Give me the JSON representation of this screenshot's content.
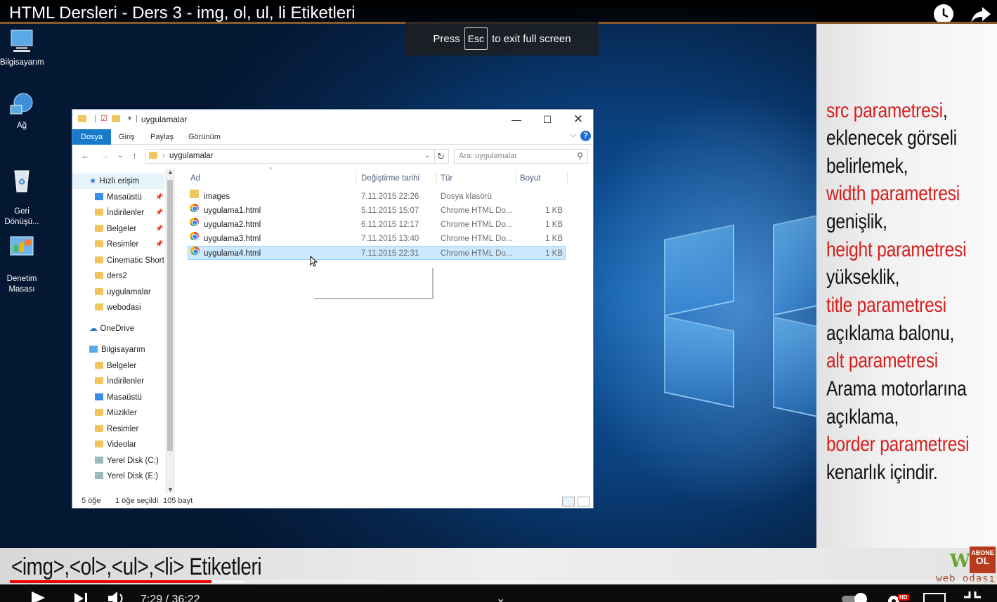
{
  "video": {
    "title": "HTML Dersleri - Ders 3 - img, ol, ul, li Etiketleri",
    "fullscreen_toast": {
      "before": "Press",
      "key": "Esc",
      "after": "to exit full screen"
    },
    "time": "7:29 / 36:22",
    "progress": 0.206,
    "buffered": 0.24,
    "hd_badge": "HD"
  },
  "desktop_icons": [
    {
      "label": "Bilgisayarım",
      "icon": "computer-icon"
    },
    {
      "label": "Ağ",
      "icon": "network-icon"
    },
    {
      "label": "Geri\nDönüşü...",
      "icon": "recycle-bin-icon"
    },
    {
      "label": "Denetim\nMasası",
      "icon": "control-panel-icon"
    }
  ],
  "explorer": {
    "title": "uygulamalar",
    "tabs": [
      "Dosya",
      "Giriş",
      "Paylaş",
      "Görünüm"
    ],
    "address": "uygulamalar",
    "search_placeholder": "Ara: uygulamalar",
    "sidebar": {
      "quick_access": "Hızlı erişim",
      "quick_items": [
        "Masaüstü",
        "İndirilenler",
        "Belgeler",
        "Resimler",
        "Cinematic Short",
        "ders2",
        "uygulamalar",
        "webodasi"
      ],
      "onedrive": "OneDrive",
      "computer": "Bilgisayarım",
      "computer_items": [
        "Belgeler",
        "İndirilenler",
        "Masaüstü",
        "Müzikler",
        "Resimler",
        "Videolar",
        "Yerel Disk (C:)",
        "Yerel Disk (E:)"
      ]
    },
    "columns": [
      "Ad",
      "Değiştirme tarihi",
      "Tür",
      "Boyut"
    ],
    "files": [
      {
        "name": "images",
        "date": "7.11.2015 22:26",
        "type": "Dosya klasörü",
        "size": "",
        "icon": "folder-icon"
      },
      {
        "name": "uygulama1.html",
        "date": "5.11.2015 15:07",
        "type": "Chrome HTML Do...",
        "size": "1 KB",
        "icon": "chrome-icon"
      },
      {
        "name": "uygulama2.html",
        "date": "6.11.2015 12:17",
        "type": "Chrome HTML Do...",
        "size": "1 KB",
        "icon": "chrome-icon"
      },
      {
        "name": "uygulama3.html",
        "date": "7.11.2015 13:40",
        "type": "Chrome HTML Do...",
        "size": "1 KB",
        "icon": "chrome-icon"
      },
      {
        "name": "uygulama4.html",
        "date": "7.11.2015 22:31",
        "type": "Chrome HTML Do...",
        "size": "1 KB",
        "icon": "chrome-icon",
        "selected": true
      }
    ],
    "status": {
      "count": "5 öğe",
      "selected": "1 öğe seçildi",
      "size": "105 bayt"
    }
  },
  "caption_panel": [
    {
      "text": "src parametresi,",
      "red_part": "src parametresi"
    },
    {
      "text": "eklenecek görseli"
    },
    {
      "text": "belirlemek,"
    },
    {
      "text": "width parametresi",
      "red_part": "width parametresi"
    },
    {
      "text": "genişlik,"
    },
    {
      "text": "height parametresi",
      "red_part": "height parametresi"
    },
    {
      "text": "yükseklik,"
    },
    {
      "text": "title parametresi",
      "red_part": "title parametresi"
    },
    {
      "text": "açıklama balonu,"
    },
    {
      "text": "alt parametresi",
      "red_part": "alt parametresi"
    },
    {
      "text": "Arama motorlarına"
    },
    {
      "text": "açıklama,"
    },
    {
      "text": "border parametresi",
      "red_part": "border parametresi"
    },
    {
      "text": "kenarlık içindir."
    }
  ],
  "lower_third": "<img>,<ol>,<ul>,<li> Etiketleri",
  "brand": {
    "abone": "ABONE",
    "ol": "OL",
    "name": "web odası"
  },
  "colors": {
    "accent_red": "#d81e1e",
    "explorer_tab": "#1979ca",
    "progress": "#ee0000"
  }
}
